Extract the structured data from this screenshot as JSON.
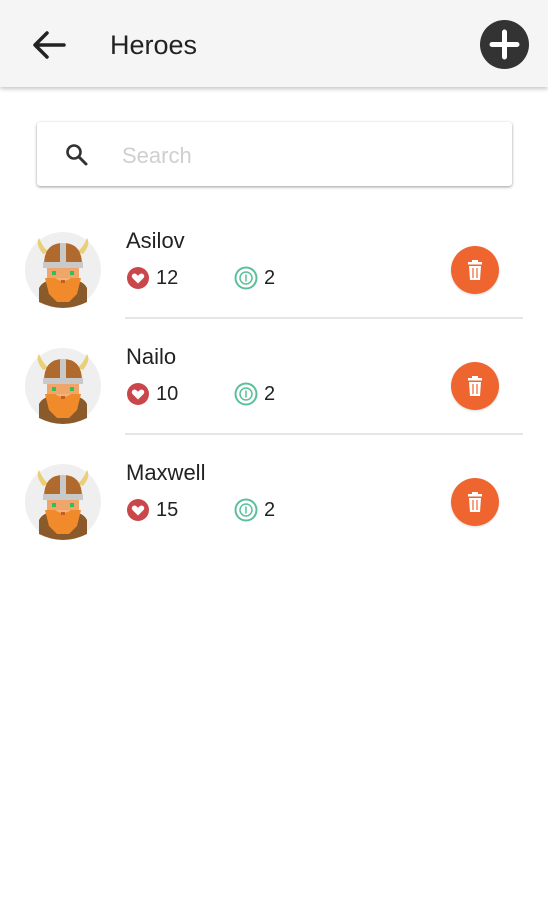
{
  "header": {
    "title": "Heroes",
    "back_icon": "arrow-left-icon",
    "add_icon": "plus-circle-icon"
  },
  "search": {
    "placeholder": "Search",
    "value": "",
    "icon": "search-icon"
  },
  "heroes": [
    {
      "name": "Asilov",
      "hp": "12",
      "xp": "2"
    },
    {
      "name": "Nailo",
      "hp": "10",
      "xp": "2"
    },
    {
      "name": "Maxwell",
      "hp": "15",
      "xp": "2"
    }
  ],
  "colors": {
    "accent": "#ee6530",
    "heart": "#c9474b",
    "coin": "#5bbf9b",
    "appbar": "#f5f5f5",
    "add_button": "#333333"
  }
}
